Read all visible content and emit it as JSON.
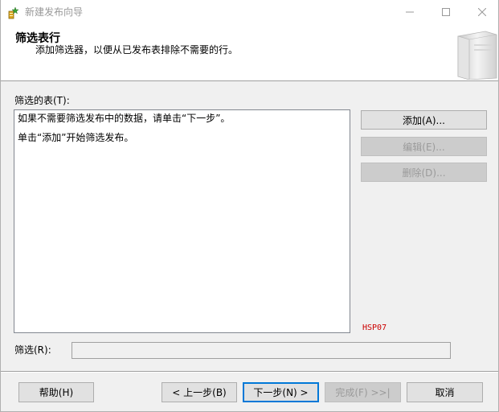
{
  "window": {
    "title": "新建发布向导"
  },
  "header": {
    "title": "筛选表行",
    "subtitle": "添加筛选器，以便从已发布表排除不需要的行。"
  },
  "filtered_tables": {
    "label": "筛选的表(T):",
    "lines": [
      "如果不需要筛选发布中的数据，请单击“下一步”。",
      "单击“添加”开始筛选发布。"
    ]
  },
  "side_buttons": {
    "add": "添加(A)...",
    "edit": "编辑(E)...",
    "delete": "删除(D)..."
  },
  "hsp_code": "HSP07",
  "filter": {
    "label": "筛选(R):",
    "value": ""
  },
  "footer": {
    "help": "帮助(H)",
    "back": "< 上一步(B)",
    "next": "下一步(N) >",
    "finish": "完成(F) >>|",
    "cancel": "取消"
  },
  "icons": {
    "app": "wizard-app-icon",
    "minimize": "minimize-icon",
    "maximize": "maximize-icon",
    "close": "close-icon",
    "header": "book-graphic"
  }
}
